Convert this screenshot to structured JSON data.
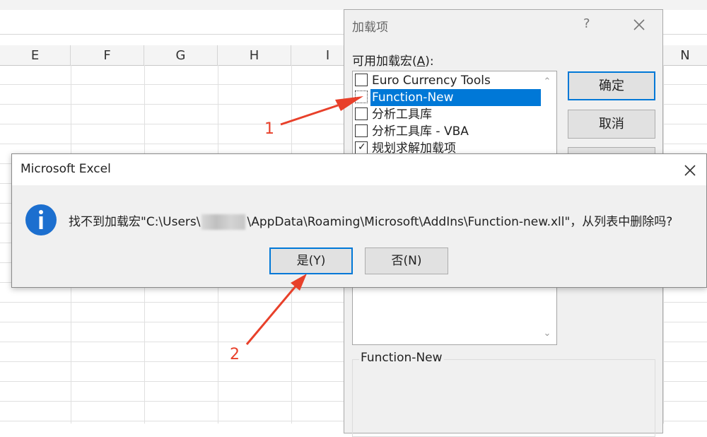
{
  "sheet": {
    "columns": [
      "E",
      "F",
      "G",
      "H",
      "I",
      "N"
    ]
  },
  "addins_dialog": {
    "title": "加载项",
    "help_label": "?",
    "available_label_prefix": "可用加载宏(",
    "available_label_key": "A",
    "available_label_suffix": "):",
    "items": [
      {
        "label": "Euro Currency Tools",
        "checked": false,
        "selected": false
      },
      {
        "label": "Function-New",
        "checked": false,
        "selected": true
      },
      {
        "label": "分析工具库",
        "checked": false,
        "selected": false
      },
      {
        "label": "分析工具库 - VBA",
        "checked": false,
        "selected": false
      },
      {
        "label": "规划求解加载项",
        "checked": true,
        "selected": false
      }
    ],
    "ok_label": "确定",
    "cancel_label": "取消",
    "description_title": "Function-New"
  },
  "message_box": {
    "title": "Microsoft Excel",
    "text_before": "找不到加载宏\"C:\\Users\\",
    "text_after": "\\AppData\\Roaming\\Microsoft\\AddIns\\Function-new.xll\"，从列表中删除吗?",
    "yes_label": "是(Y)",
    "no_label": "否(N)"
  },
  "annotations": {
    "step1": "1",
    "step2": "2",
    "color": "#e8402a"
  }
}
